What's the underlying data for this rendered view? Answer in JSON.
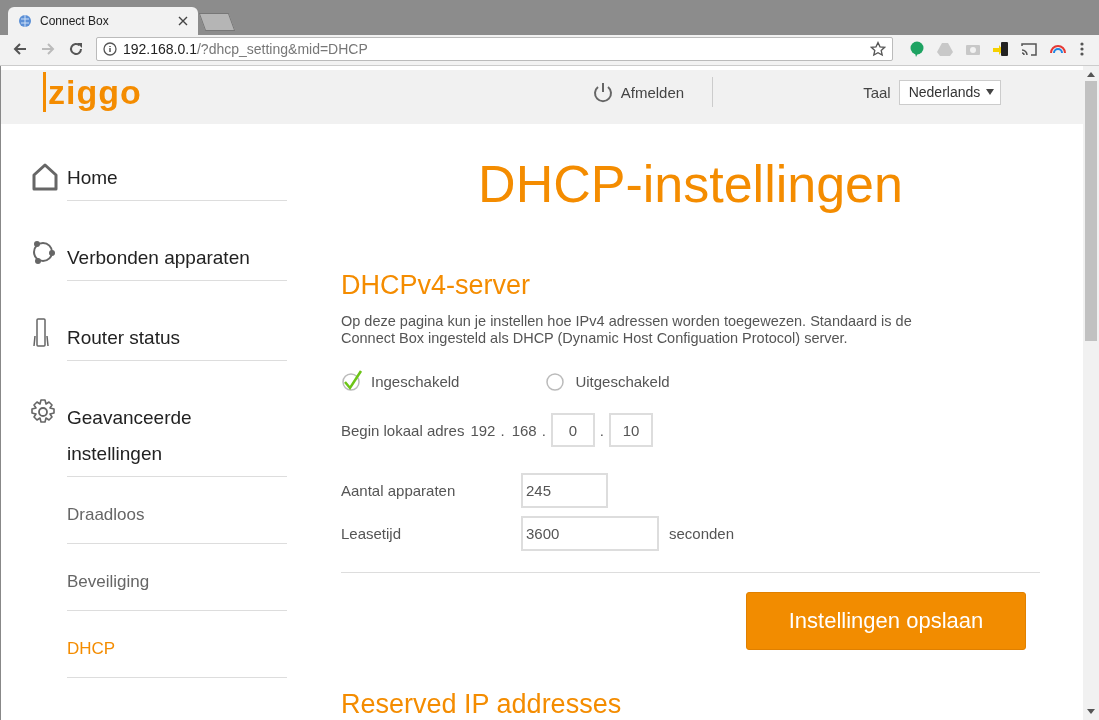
{
  "browser": {
    "tab_title": "Connect Box",
    "address": {
      "host": "192.168.0.1",
      "path": "/?dhcp_setting&mid=DHCP"
    }
  },
  "header": {
    "logo": "ziggo",
    "logout": "Afmelden",
    "language_label": "Taal",
    "language": "Nederlands"
  },
  "sidebar": {
    "items": [
      {
        "label": "Home",
        "selected": false
      },
      {
        "label": "Verbonden apparaten",
        "selected": false
      },
      {
        "label": "Router status",
        "selected": false
      },
      {
        "label": "Geavanceerde instellingen",
        "selected": false,
        "children": [
          {
            "label": "Draadloos",
            "selected": false
          },
          {
            "label": "Beveiliging",
            "selected": false
          },
          {
            "label": "DHCP",
            "selected": true
          }
        ]
      }
    ]
  },
  "main": {
    "title": "DHCP-instellingen",
    "section": "DHCPv4-server",
    "description": "Op deze pagina kun je instellen hoe IPv4 adressen worden toegewezen. Standaard is de Connect Box ingesteld als DHCP (Dynamic Host Configuation Protocol) server.",
    "radios": [
      {
        "label": "Ingeschakeld",
        "selected": true
      },
      {
        "label": "Uitgeschakeld",
        "selected": false
      }
    ],
    "begin_address": {
      "label": "Begin lokaal adres",
      "fixed": [
        "192",
        "168"
      ],
      "fields": [
        "0",
        "10"
      ],
      "separator": "."
    },
    "device_count": {
      "label": "Aantal apparaten",
      "value": "245"
    },
    "lease_time": {
      "label": "Leasetijd",
      "value": "3600",
      "unit": "seconden"
    },
    "save_button": "Instellingen opslaan",
    "next_section": "Reserved IP addresses"
  }
}
